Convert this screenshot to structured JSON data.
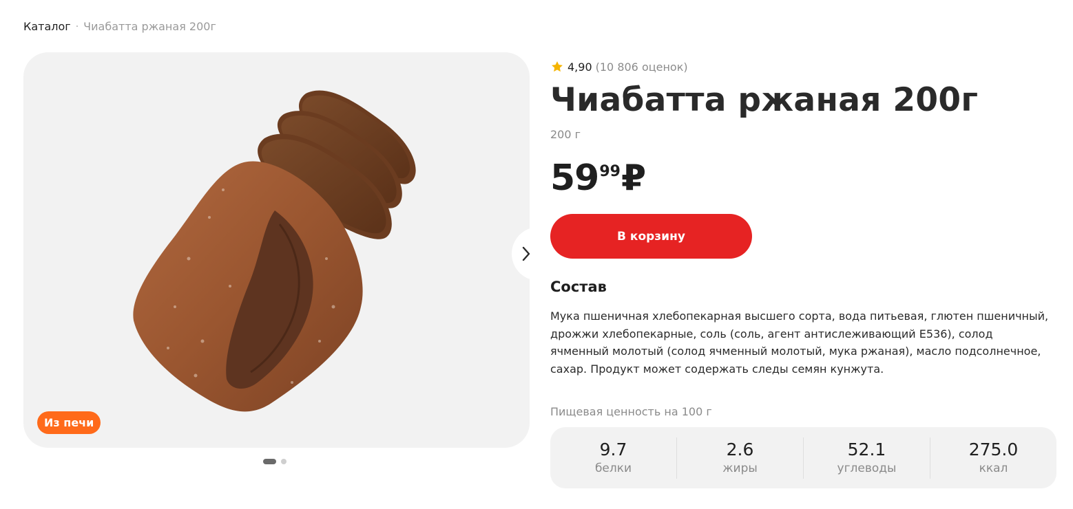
{
  "breadcrumb": {
    "catalog_label": "Каталог",
    "separator": "·",
    "current_label": "Чиабатта ржаная 200г"
  },
  "gallery": {
    "badge_label": "Из печи",
    "image_subject": "rye ciabatta bread loaf with slices",
    "next_icon": "chevron-right-icon",
    "dots_total": 2,
    "dots_active_index": 0
  },
  "product": {
    "rating_value": "4,90",
    "rating_count": "(10 806 оценок)",
    "title": "Чиабатта ржаная 200г",
    "weight": "200 г",
    "price_integer": "59",
    "price_fraction": "99",
    "price_currency": "₽",
    "cart_button_label": "В корзину"
  },
  "composition": {
    "title": "Состав",
    "text": "Мука пшеничная хлебопекарная высшего сорта, вода питьевая, глютен пшеничный, дрожжи хлебопекарные, соль (соль, агент антислеживающий Е536), солод ячменный молотый (солод ячменный молотый, мука ржаная), масло подсолнечное, сахар. Продукт может содержать следы семян кунжута."
  },
  "nutrition": {
    "label": "Пищевая ценность на 100 г",
    "items": [
      {
        "value": "9.7",
        "name": "белки"
      },
      {
        "value": "2.6",
        "name": "жиры"
      },
      {
        "value": "52.1",
        "name": "углеводы"
      },
      {
        "value": "275.0",
        "name": "ккал"
      }
    ]
  },
  "colors": {
    "accent_red": "#e62323",
    "badge_orange": "#ff6a1a",
    "star_yellow": "#f5b400",
    "panel_gray": "#f2f2f2"
  }
}
